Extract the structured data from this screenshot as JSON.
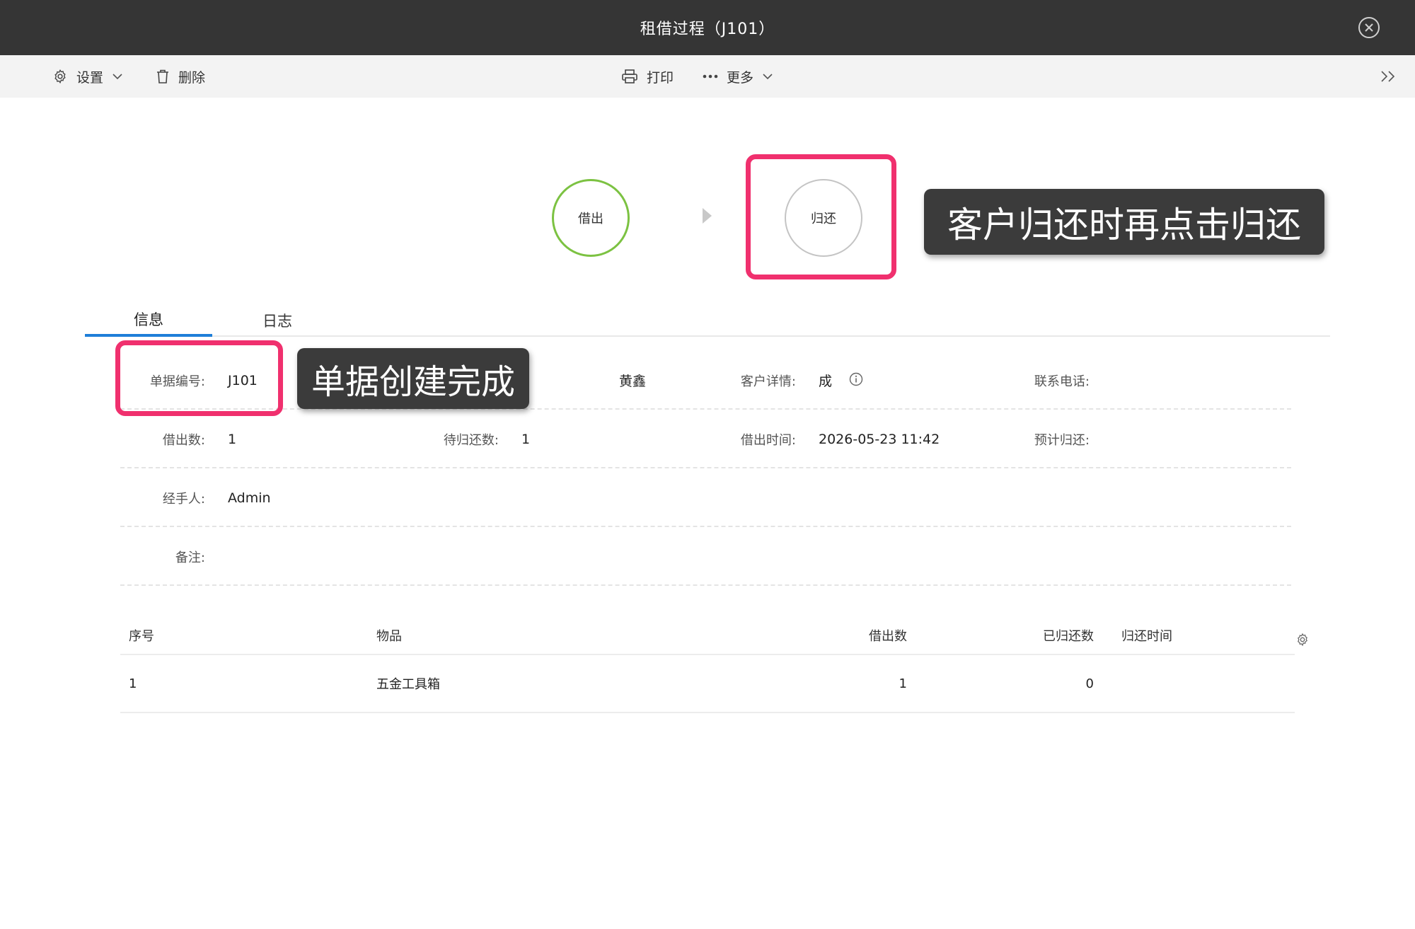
{
  "window": {
    "title": "租借过程（J101）"
  },
  "toolbar": {
    "settings_label": "设置",
    "delete_label": "删除",
    "print_label": "打印",
    "more_label": "更多",
    "expand_glyph": "››"
  },
  "steps": [
    {
      "label": "借出",
      "status": "done",
      "color": "#7cc242"
    },
    {
      "label": "归还",
      "status": "pending",
      "color": "#c4c4c4"
    }
  ],
  "annotations": {
    "return_tip": "客户归还时再点击归还",
    "created_tip": "单据创建完成",
    "highlight_color": "#f0306e"
  },
  "tabs": [
    {
      "label": "信息",
      "active": true
    },
    {
      "label": "日志",
      "active": false
    }
  ],
  "info": {
    "doc_no_label": "单据编号:",
    "doc_no": "J101",
    "customer_hidden_fragment": "黄鑫",
    "customer_detail_label": "客户详情:",
    "customer_detail": "成",
    "phone_label": "联系电话:",
    "phone": "",
    "lent_count_label": "借出数:",
    "lent_count": "1",
    "pending_return_label": "待归还数:",
    "pending_return": "1",
    "lent_time_label": "借出时间:",
    "lent_time": "2026-05-23 11:42",
    "expected_return_label": "预计归还:",
    "expected_return": "",
    "handler_label": "经手人:",
    "handler": "Admin",
    "remark_label": "备注:",
    "remark": ""
  },
  "table": {
    "headers": {
      "seq": "序号",
      "item": "物品",
      "lent": "借出数",
      "returned": "已归还数",
      "return_time": "归还时间"
    },
    "rows": [
      {
        "seq": "1",
        "item": "五金工具箱",
        "lent": "1",
        "returned": "0",
        "return_time": ""
      }
    ]
  },
  "colors": {
    "accent": "#1e7ed8",
    "titlebar": "#353535",
    "toolbar": "#f3f3f3"
  }
}
